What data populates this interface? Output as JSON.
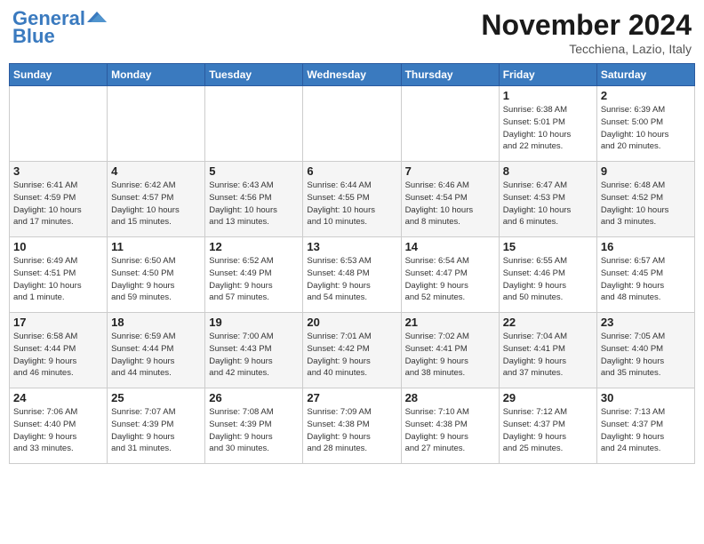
{
  "header": {
    "logo_line1": "General",
    "logo_line2": "Blue",
    "month_title": "November 2024",
    "location": "Tecchiena, Lazio, Italy"
  },
  "weekdays": [
    "Sunday",
    "Monday",
    "Tuesday",
    "Wednesday",
    "Thursday",
    "Friday",
    "Saturday"
  ],
  "weeks": [
    [
      {
        "day": "",
        "info": ""
      },
      {
        "day": "",
        "info": ""
      },
      {
        "day": "",
        "info": ""
      },
      {
        "day": "",
        "info": ""
      },
      {
        "day": "",
        "info": ""
      },
      {
        "day": "1",
        "info": "Sunrise: 6:38 AM\nSunset: 5:01 PM\nDaylight: 10 hours\nand 22 minutes."
      },
      {
        "day": "2",
        "info": "Sunrise: 6:39 AM\nSunset: 5:00 PM\nDaylight: 10 hours\nand 20 minutes."
      }
    ],
    [
      {
        "day": "3",
        "info": "Sunrise: 6:41 AM\nSunset: 4:59 PM\nDaylight: 10 hours\nand 17 minutes."
      },
      {
        "day": "4",
        "info": "Sunrise: 6:42 AM\nSunset: 4:57 PM\nDaylight: 10 hours\nand 15 minutes."
      },
      {
        "day": "5",
        "info": "Sunrise: 6:43 AM\nSunset: 4:56 PM\nDaylight: 10 hours\nand 13 minutes."
      },
      {
        "day": "6",
        "info": "Sunrise: 6:44 AM\nSunset: 4:55 PM\nDaylight: 10 hours\nand 10 minutes."
      },
      {
        "day": "7",
        "info": "Sunrise: 6:46 AM\nSunset: 4:54 PM\nDaylight: 10 hours\nand 8 minutes."
      },
      {
        "day": "8",
        "info": "Sunrise: 6:47 AM\nSunset: 4:53 PM\nDaylight: 10 hours\nand 6 minutes."
      },
      {
        "day": "9",
        "info": "Sunrise: 6:48 AM\nSunset: 4:52 PM\nDaylight: 10 hours\nand 3 minutes."
      }
    ],
    [
      {
        "day": "10",
        "info": "Sunrise: 6:49 AM\nSunset: 4:51 PM\nDaylight: 10 hours\nand 1 minute."
      },
      {
        "day": "11",
        "info": "Sunrise: 6:50 AM\nSunset: 4:50 PM\nDaylight: 9 hours\nand 59 minutes."
      },
      {
        "day": "12",
        "info": "Sunrise: 6:52 AM\nSunset: 4:49 PM\nDaylight: 9 hours\nand 57 minutes."
      },
      {
        "day": "13",
        "info": "Sunrise: 6:53 AM\nSunset: 4:48 PM\nDaylight: 9 hours\nand 54 minutes."
      },
      {
        "day": "14",
        "info": "Sunrise: 6:54 AM\nSunset: 4:47 PM\nDaylight: 9 hours\nand 52 minutes."
      },
      {
        "day": "15",
        "info": "Sunrise: 6:55 AM\nSunset: 4:46 PM\nDaylight: 9 hours\nand 50 minutes."
      },
      {
        "day": "16",
        "info": "Sunrise: 6:57 AM\nSunset: 4:45 PM\nDaylight: 9 hours\nand 48 minutes."
      }
    ],
    [
      {
        "day": "17",
        "info": "Sunrise: 6:58 AM\nSunset: 4:44 PM\nDaylight: 9 hours\nand 46 minutes."
      },
      {
        "day": "18",
        "info": "Sunrise: 6:59 AM\nSunset: 4:44 PM\nDaylight: 9 hours\nand 44 minutes."
      },
      {
        "day": "19",
        "info": "Sunrise: 7:00 AM\nSunset: 4:43 PM\nDaylight: 9 hours\nand 42 minutes."
      },
      {
        "day": "20",
        "info": "Sunrise: 7:01 AM\nSunset: 4:42 PM\nDaylight: 9 hours\nand 40 minutes."
      },
      {
        "day": "21",
        "info": "Sunrise: 7:02 AM\nSunset: 4:41 PM\nDaylight: 9 hours\nand 38 minutes."
      },
      {
        "day": "22",
        "info": "Sunrise: 7:04 AM\nSunset: 4:41 PM\nDaylight: 9 hours\nand 37 minutes."
      },
      {
        "day": "23",
        "info": "Sunrise: 7:05 AM\nSunset: 4:40 PM\nDaylight: 9 hours\nand 35 minutes."
      }
    ],
    [
      {
        "day": "24",
        "info": "Sunrise: 7:06 AM\nSunset: 4:40 PM\nDaylight: 9 hours\nand 33 minutes."
      },
      {
        "day": "25",
        "info": "Sunrise: 7:07 AM\nSunset: 4:39 PM\nDaylight: 9 hours\nand 31 minutes."
      },
      {
        "day": "26",
        "info": "Sunrise: 7:08 AM\nSunset: 4:39 PM\nDaylight: 9 hours\nand 30 minutes."
      },
      {
        "day": "27",
        "info": "Sunrise: 7:09 AM\nSunset: 4:38 PM\nDaylight: 9 hours\nand 28 minutes."
      },
      {
        "day": "28",
        "info": "Sunrise: 7:10 AM\nSunset: 4:38 PM\nDaylight: 9 hours\nand 27 minutes."
      },
      {
        "day": "29",
        "info": "Sunrise: 7:12 AM\nSunset: 4:37 PM\nDaylight: 9 hours\nand 25 minutes."
      },
      {
        "day": "30",
        "info": "Sunrise: 7:13 AM\nSunset: 4:37 PM\nDaylight: 9 hours\nand 24 minutes."
      }
    ]
  ]
}
